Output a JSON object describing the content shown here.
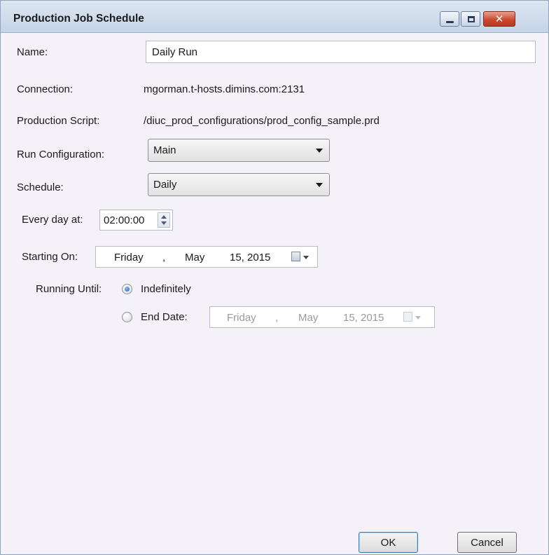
{
  "window": {
    "title": "Production Job Schedule",
    "buttons": {
      "minimize": "minimize-icon",
      "maximize": "maximize-icon",
      "close": "close-icon"
    }
  },
  "form": {
    "name_label": "Name:",
    "name_value": "Daily Run",
    "connection_label": "Connection:",
    "connection_value": "mgorman.t-hosts.dimins.com:2131",
    "script_label": "Production Script:",
    "script_value": "/diuc_prod_configurations/prod_config_sample.prd",
    "run_config_label": "Run Configuration:",
    "run_config_value": "Main",
    "schedule_label": "Schedule:",
    "schedule_value": "Daily"
  },
  "daily": {
    "every_day_label": "Every day at:",
    "time_value": "02:00:00"
  },
  "starting": {
    "label": "Starting On:",
    "weekday": "Friday",
    "comma": ",",
    "month": "May",
    "day_year": "15, 2015"
  },
  "running_until": {
    "label": "Running Until:",
    "indefinitely_label": "Indefinitely",
    "indefinitely_checked": true,
    "end_date_label": "End Date:",
    "end_date_checked": false,
    "end_weekday": "Friday",
    "end_comma": ",",
    "end_month": "May",
    "end_day_year": "15, 2015"
  },
  "footer": {
    "ok_label": "OK",
    "cancel_label": "Cancel"
  }
}
